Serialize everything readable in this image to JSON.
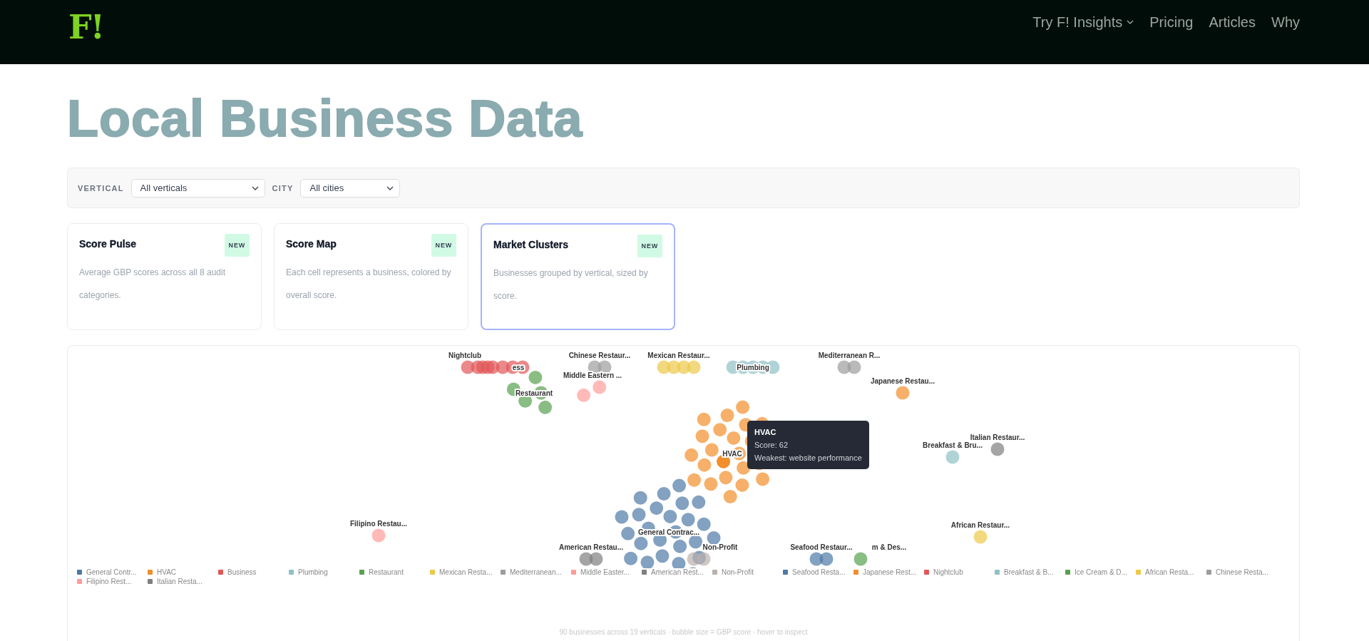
{
  "header": {
    "logo": "F!",
    "nav": [
      {
        "label": "Try F! Insights",
        "dropdown": true
      },
      {
        "label": "Pricing",
        "dropdown": false
      },
      {
        "label": "Articles",
        "dropdown": false
      },
      {
        "label": "Why",
        "dropdown": false
      }
    ]
  },
  "title": "Local Business Data",
  "filters": [
    {
      "label": "VERTICAL",
      "value": "All verticals"
    },
    {
      "label": "CITY",
      "value": "All cities"
    }
  ],
  "cards": [
    {
      "title": "Score Pulse",
      "badge": "NEW",
      "description": "Average GBP scores across all 8 audit categories.",
      "selected": false
    },
    {
      "title": "Score Map",
      "badge": "NEW",
      "description": "Each cell represents a business, colored by overall score.",
      "selected": false
    },
    {
      "title": "Market Clusters",
      "badge": "NEW",
      "description": "Businesses grouped by vertical, sized by score.",
      "selected": true
    }
  ],
  "clusters": {
    "verticals": [
      {
        "bubble_label": "General Contrac...",
        "legend": "General Contr...",
        "color": "#4e79a7"
      },
      {
        "bubble_label": "HVAC",
        "legend": "HVAC",
        "color": "#f28e2b"
      },
      {
        "bubble_label": "ess",
        "legend": "Business",
        "color": "#e15759"
      },
      {
        "bubble_label": "Plumbing",
        "legend": "Plumbing",
        "color": "#8fc1c4"
      },
      {
        "bubble_label": "Restaurant",
        "legend": "Restaurant",
        "color": "#59a14f"
      },
      {
        "bubble_label": "Mexican Restaur...",
        "legend": "Mexican Resta...",
        "color": "#edc948"
      },
      {
        "bubble_label": "Mediterranean R...",
        "legend": "Mediterranean...",
        "color": "#9d9d9d"
      },
      {
        "bubble_label": "Middle Eastern ...",
        "legend": "Middle Easter...",
        "color": "#ff9d9a"
      },
      {
        "bubble_label": "American Restau...",
        "legend": "American Rest...",
        "color": "#7f7f7f"
      },
      {
        "bubble_label": "Non-Profit",
        "legend": "Non-Profit",
        "color": "#bab0ac"
      },
      {
        "bubble_label": "Seafood Restaur...",
        "legend": "Seafood Resta...",
        "color": "#4e79a7"
      },
      {
        "bubble_label": "Japanese Restau...",
        "legend": "Japanese Rest...",
        "color": "#f28e2b"
      },
      {
        "bubble_label": "Nightclub",
        "legend": "Nightclub",
        "color": "#e15759"
      },
      {
        "bubble_label": "Breakfast & Bru...",
        "legend": "Breakfast & B...",
        "color": "#8fc1c4"
      },
      {
        "bubble_label": "m & Des...",
        "legend": "Ice Cream & D...",
        "color": "#59a14f"
      },
      {
        "bubble_label": "African Restaur...",
        "legend": "African Resta...",
        "color": "#edc948"
      },
      {
        "bubble_label": "Chinese Restaur...",
        "legend": "Chinese Resta...",
        "color": "#9d9d9d"
      },
      {
        "bubble_label": "Filipino Restau...",
        "legend": "Filipino Rest...",
        "color": "#ff9d9a"
      },
      {
        "bubble_label": "Italian Restaur...",
        "legend": "Italian Resta...",
        "color": "#7f7f7f"
      }
    ],
    "tooltip": {
      "title": "HVAC",
      "lines": [
        "Score: 62",
        "Weakest: website performance"
      ]
    },
    "caption": "90 businesses across 19 verticals · bubble size = GBP score · hover to inspect"
  }
}
